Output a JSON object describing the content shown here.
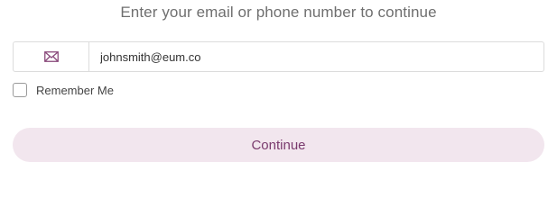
{
  "subtitle": "Enter your email or phone number to continue",
  "login_field": {
    "icon": "envelope-icon",
    "value": "johnsmith@eum.co",
    "placeholder": ""
  },
  "remember": {
    "label": "Remember Me",
    "checked": false
  },
  "continue_button": {
    "label": "Continue"
  },
  "colors": {
    "accent": "#7a3b6e",
    "button_bg": "#f2e6ee",
    "icon": "#8a4a7c"
  }
}
